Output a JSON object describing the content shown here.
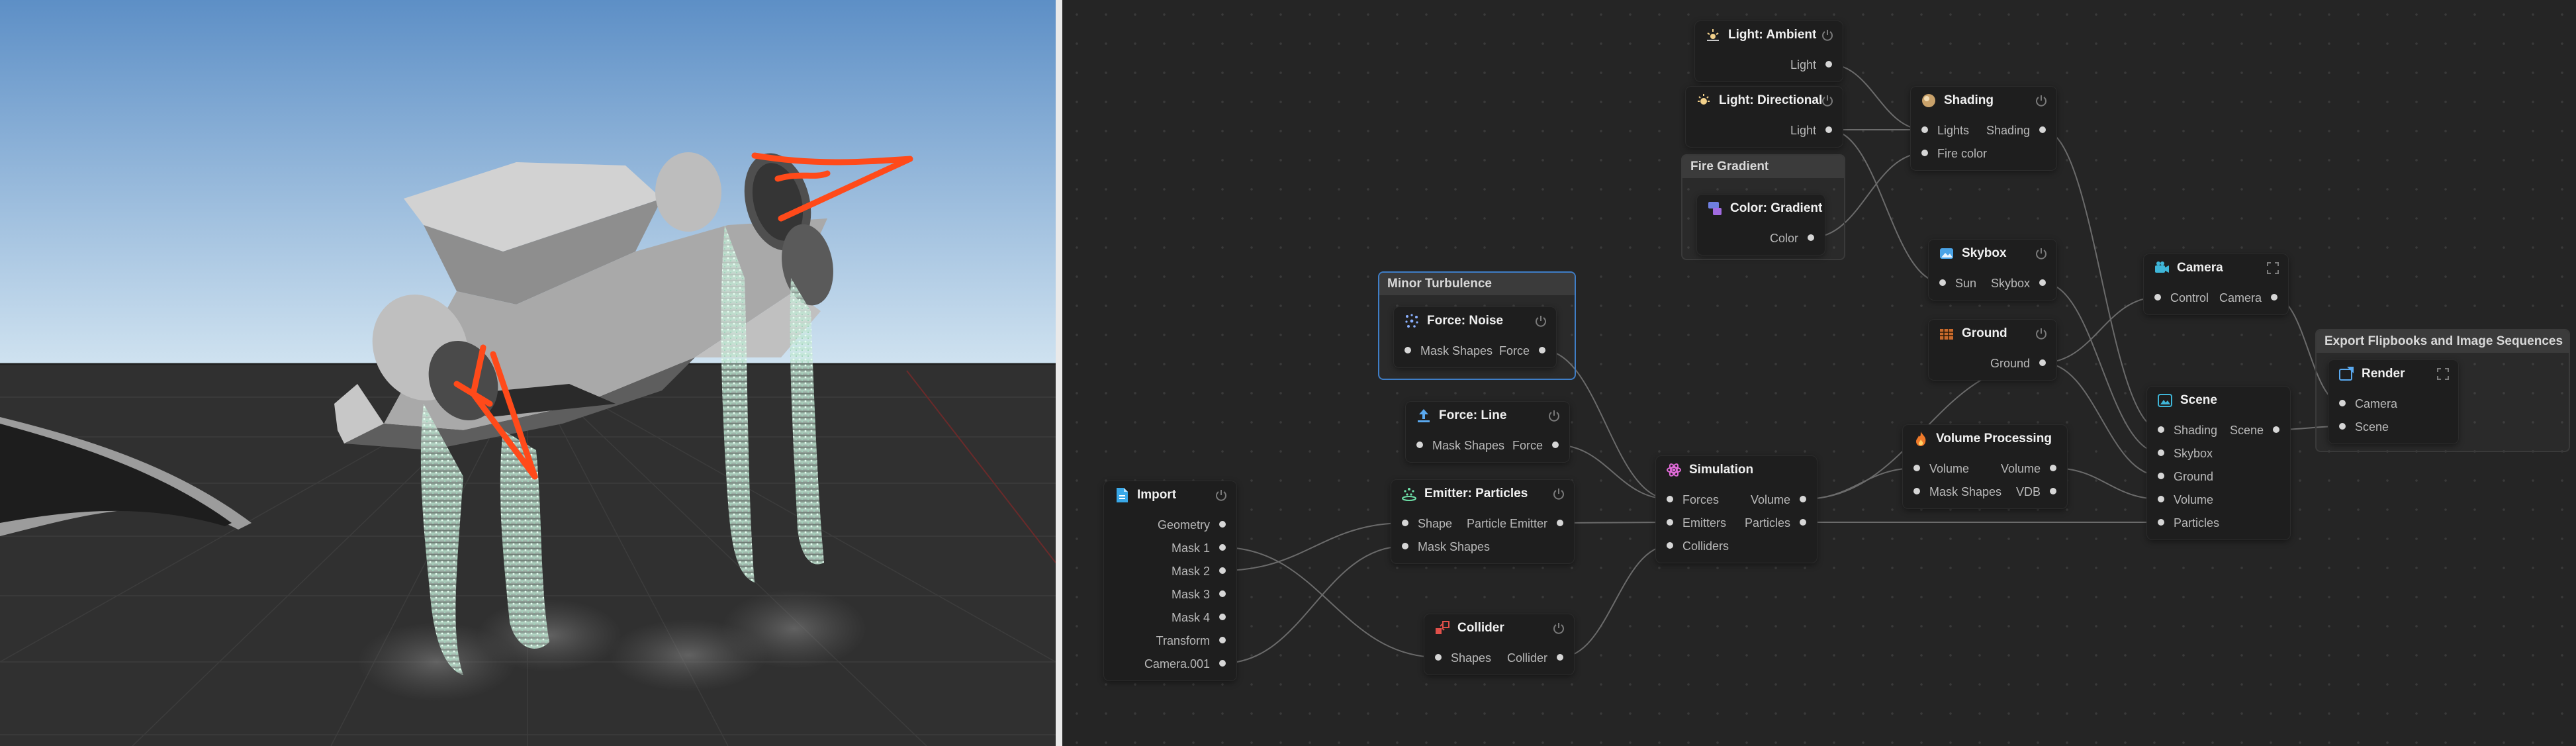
{
  "nodes": {
    "light_ambient": {
      "title": "Light: Ambient",
      "outputs": [
        "Light"
      ]
    },
    "light_directional": {
      "title": "Light: Directional",
      "outputs": [
        "Light"
      ]
    },
    "shading": {
      "title": "Shading",
      "inputs": [
        "Lights",
        "Fire color"
      ],
      "outputs": [
        "Shading"
      ]
    },
    "color_gradient": {
      "title": "Color: Gradient",
      "outputs": [
        "Color"
      ]
    },
    "skybox": {
      "title": "Skybox",
      "inputs": [
        "Sun"
      ],
      "outputs": [
        "Skybox"
      ]
    },
    "ground": {
      "title": "Ground",
      "outputs": [
        "Ground"
      ]
    },
    "camera": {
      "title": "Camera",
      "inputs": [
        "Control"
      ],
      "outputs": [
        "Camera"
      ]
    },
    "force_noise": {
      "title": "Force: Noise",
      "inputs": [
        "Mask Shapes"
      ],
      "outputs": [
        "Force"
      ]
    },
    "force_line": {
      "title": "Force: Line",
      "inputs": [
        "Mask Shapes"
      ],
      "outputs": [
        "Force"
      ]
    },
    "import": {
      "title": "Import",
      "outputs": [
        "Geometry",
        "Mask 1",
        "Mask 2",
        "Mask 3",
        "Mask 4",
        "Transform",
        "Camera.001"
      ]
    },
    "emitter": {
      "title": "Emitter: Particles",
      "inputs": [
        "Shape",
        "Mask Shapes"
      ],
      "outputs": [
        "Particle Emitter"
      ]
    },
    "simulation": {
      "title": "Simulation",
      "inputs": [
        "Forces",
        "Emitters",
        "Colliders"
      ],
      "outputs": [
        "Volume",
        "Particles"
      ]
    },
    "volume_processing": {
      "title": "Volume Processing",
      "inputs": [
        "Volume",
        "Mask Shapes"
      ],
      "outputs": [
        "Volume",
        "VDB"
      ]
    },
    "scene": {
      "title": "Scene",
      "inputs": [
        "Shading",
        "Skybox",
        "Ground",
        "Volume",
        "Particles"
      ],
      "outputs": [
        "Scene"
      ]
    },
    "render": {
      "title": "Render",
      "inputs": [
        "Camera",
        "Scene"
      ]
    },
    "collider": {
      "title": "Collider",
      "inputs": [
        "Shapes"
      ],
      "outputs": [
        "Collider"
      ]
    }
  },
  "groups": {
    "fire_gradient": "Fire Gradient",
    "minor_turbulence": "Minor Turbulence",
    "export": "Export Flipbooks and Image Sequences"
  },
  "colors": {
    "background": "#252525",
    "node": "#1e1e1e",
    "selection": "#3f7ec7",
    "annotation": "#ff4a1a",
    "particles": "#bfe6d2"
  }
}
